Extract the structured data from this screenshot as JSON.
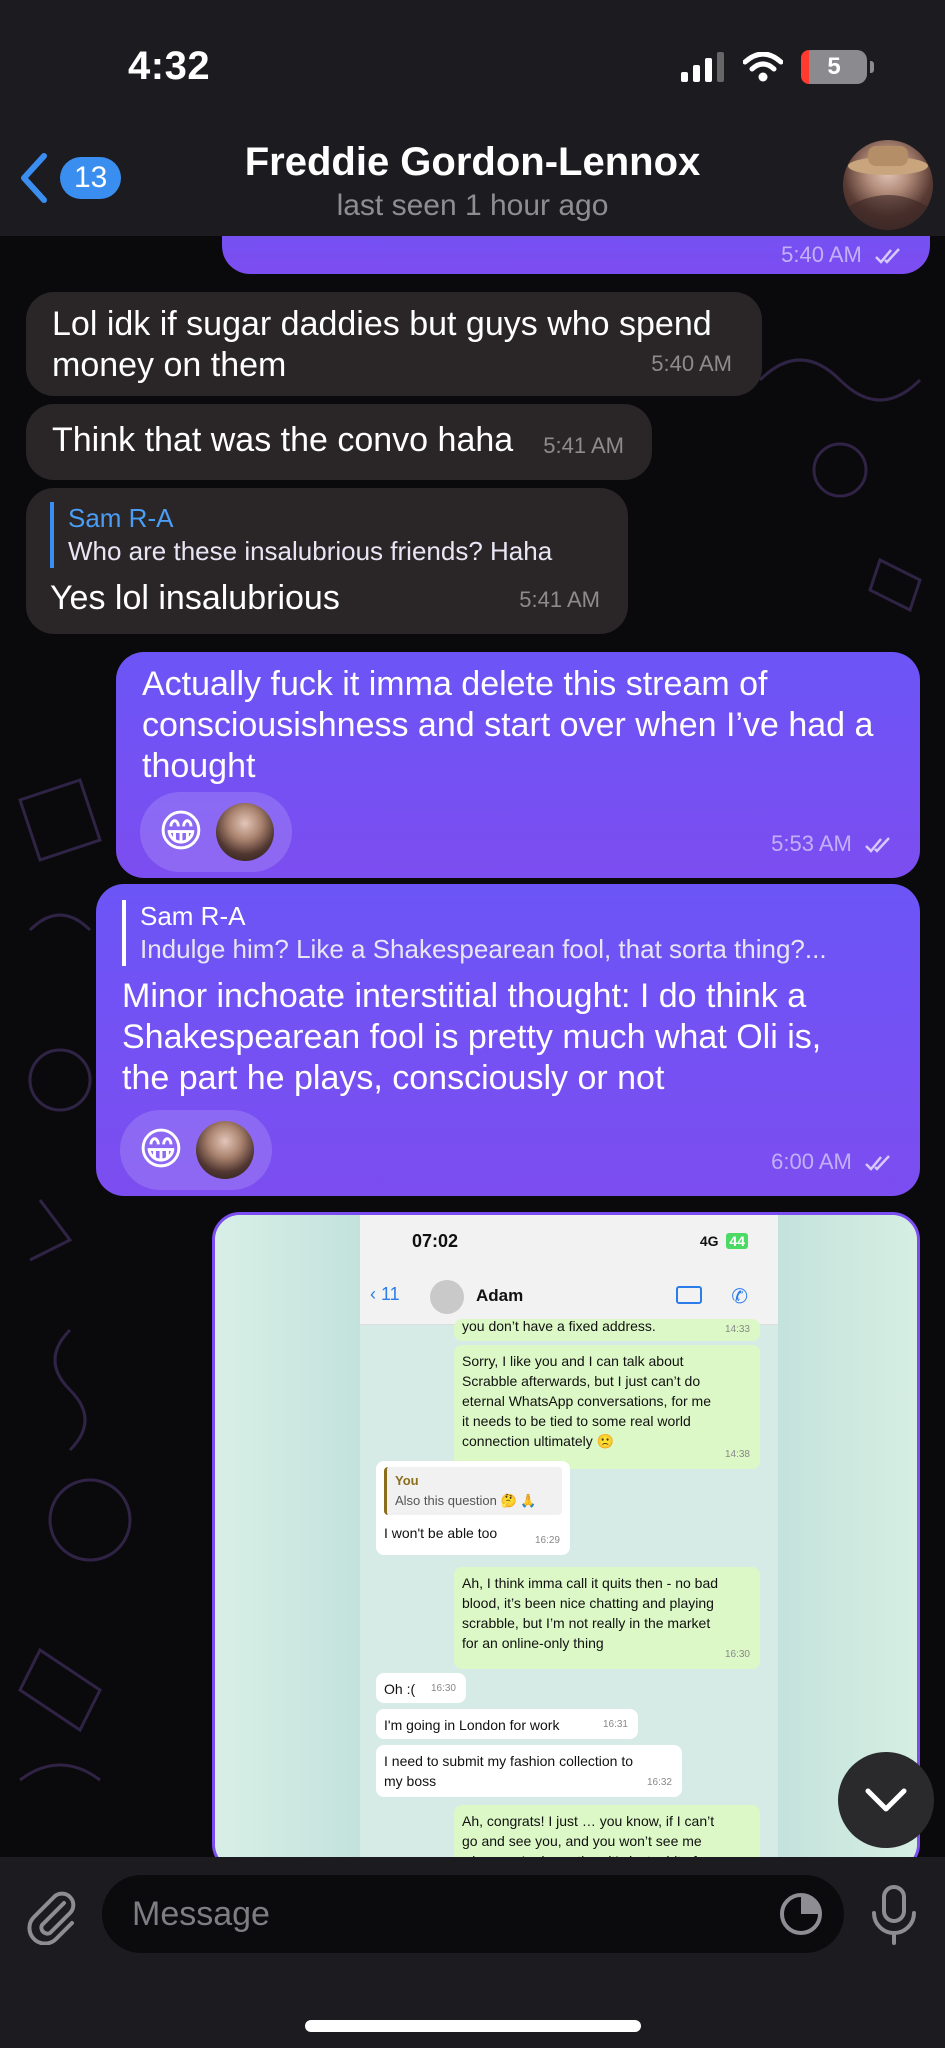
{
  "status_bar": {
    "time": "4:32",
    "battery": "5"
  },
  "header": {
    "back_count": "13",
    "name": "Freddie Gordon-Lennox",
    "last_seen": "last seen 1 hour ago"
  },
  "messages": {
    "top_partial": {
      "time": "5:40 AM"
    },
    "m1": {
      "text_line1": "Lol idk if sugar daddies but guys who spend",
      "text_line2": "money on them",
      "time": "5:40 AM"
    },
    "m2": {
      "text": "Think that was the convo haha",
      "time": "5:41 AM"
    },
    "m3": {
      "reply_name": "Sam R-A",
      "reply_text": "Who are these insalubrious friends? Haha",
      "text": "Yes lol insalubrious",
      "time": "5:41 AM"
    },
    "m4": {
      "line1": "Actually fuck it imma delete this stream of",
      "line2": "consciousishness and start over when I’ve had a",
      "line3": "thought",
      "reaction_emoji": "😁",
      "time": "5:53 AM"
    },
    "m5": {
      "reply_name": "Sam R-A",
      "reply_text": "Indulge him? Like a Shakespearean fool, that sorta thing?...",
      "line1": "Minor inchoate interstitial thought: I do think a",
      "line2": "Shakespearean fool is pretty much what Oli is,",
      "line3": "the part he plays, consciously or not",
      "reaction_emoji": "😁",
      "time": "6:00 AM"
    }
  },
  "screenshot": {
    "time": "07:02",
    "network": "4G",
    "battery": "44",
    "back_count": "11",
    "contact": "Adam",
    "cut_top": "you don’t have a fixed address.",
    "cut_top_time": "14:33",
    "b1": {
      "l1": "Sorry, I like you and I can talk about",
      "l2": "Scrabble afterwards, but I just can’t do",
      "l3": "eternal WhatsApp conversations, for me",
      "l4": "it needs to be tied to some real world",
      "l5": "connection ultimately 🙁",
      "time": "14:38"
    },
    "b2": {
      "quote_name": "You",
      "quote_text": "Also this question 🤔 🙏",
      "text": "I won't be able too",
      "time": "16:29"
    },
    "b3": {
      "l1": "Ah, I think imma call it quits then - no bad",
      "l2": "blood, it’s been nice chatting and playing",
      "l3": "scrabble, but I’m not really in the market",
      "l4": "for an online-only thing",
      "time": "16:30"
    },
    "b4": {
      "text": "Oh :(",
      "time": "16:30"
    },
    "b5": {
      "text": "I'm going in London for work",
      "time": "16:31"
    },
    "b6": {
      "l1": "I need to submit my fashion collection to",
      "l2": "my boss",
      "time": "16:32"
    },
    "b7": {
      "l1": "Ah, congrats! I just … you know, if I can’t",
      "l2": "go and see you, and you won’t see me",
      "l3": "when you’re here, then it’s just a bit of a"
    }
  },
  "composer": {
    "placeholder": "Message"
  }
}
